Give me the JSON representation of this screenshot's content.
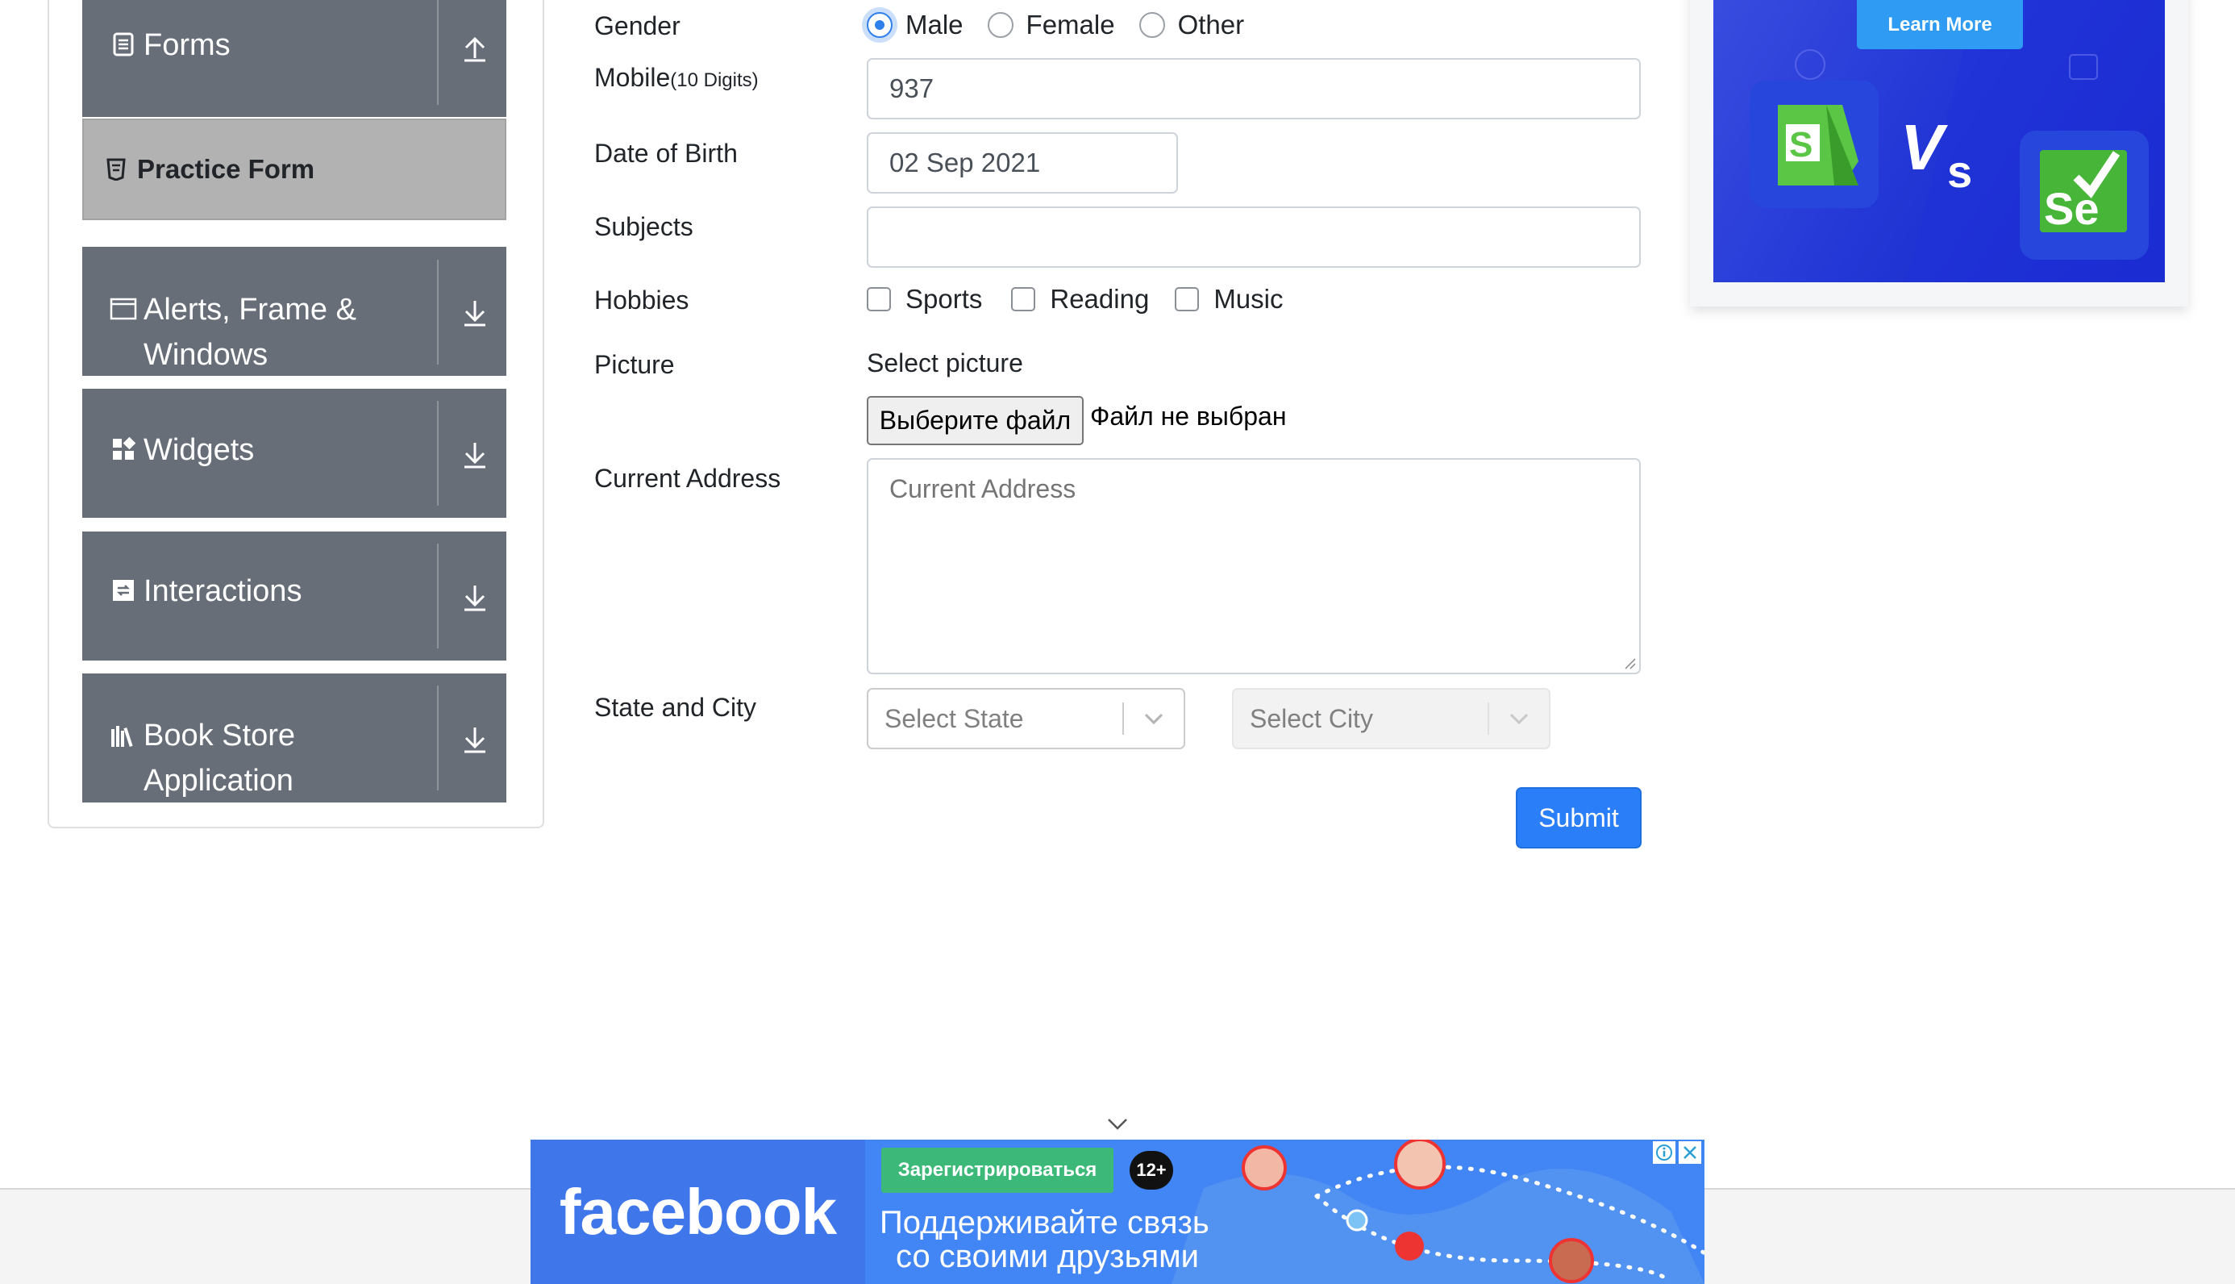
{
  "sidebar": {
    "groups": [
      {
        "label": "Forms",
        "icon": "form-icon",
        "arrow": "collapse-arrow-icon"
      },
      {
        "label_line1": "Alerts, Frame &",
        "label_line2": "Windows",
        "icon": "window-icon",
        "arrow": "expand-arrow-icon"
      },
      {
        "label": "Widgets",
        "icon": "widgets-icon",
        "arrow": "expand-arrow-icon"
      },
      {
        "label": "Interactions",
        "icon": "interactions-icon",
        "arrow": "expand-arrow-icon"
      },
      {
        "label_line1": "Book Store",
        "label_line2": "Application",
        "icon": "books-icon",
        "arrow": "expand-arrow-icon"
      }
    ],
    "active_item": {
      "label": "Practice Form",
      "icon": "html5-icon"
    }
  },
  "form": {
    "gender": {
      "label": "Gender",
      "options": [
        "Male",
        "Female",
        "Other"
      ],
      "selected": "Male"
    },
    "mobile": {
      "label": "Mobile",
      "hint": "(10 Digits)",
      "value": "937"
    },
    "dob": {
      "label": "Date of Birth",
      "value": "02 Sep 2021"
    },
    "subjects": {
      "label": "Subjects",
      "value": ""
    },
    "hobbies": {
      "label": "Hobbies",
      "options": [
        "Sports",
        "Reading",
        "Music"
      ],
      "checked": []
    },
    "picture": {
      "label": "Picture",
      "caption": "Select picture",
      "button": "Выберите файл",
      "status": "Файл не выбран"
    },
    "address": {
      "label": "Current Address",
      "placeholder": "Current Address"
    },
    "state_city": {
      "label": "State and City",
      "state_placeholder": "Select State",
      "city_placeholder": "Select City"
    },
    "submit_label": "Submit"
  },
  "ads": {
    "right": {
      "cta": "Learn More"
    },
    "bottom": {
      "brand": "facebook",
      "register": "Зарегистрироваться",
      "age": "12+",
      "line1": "Поддерживайте связь",
      "line2": "со своими друзьями"
    }
  },
  "colors": {
    "sidebar_header": "#686e77",
    "active_item": "#b2b2b2",
    "accent": "#2a7ff8",
    "fb_blue": "#3f76ea"
  }
}
